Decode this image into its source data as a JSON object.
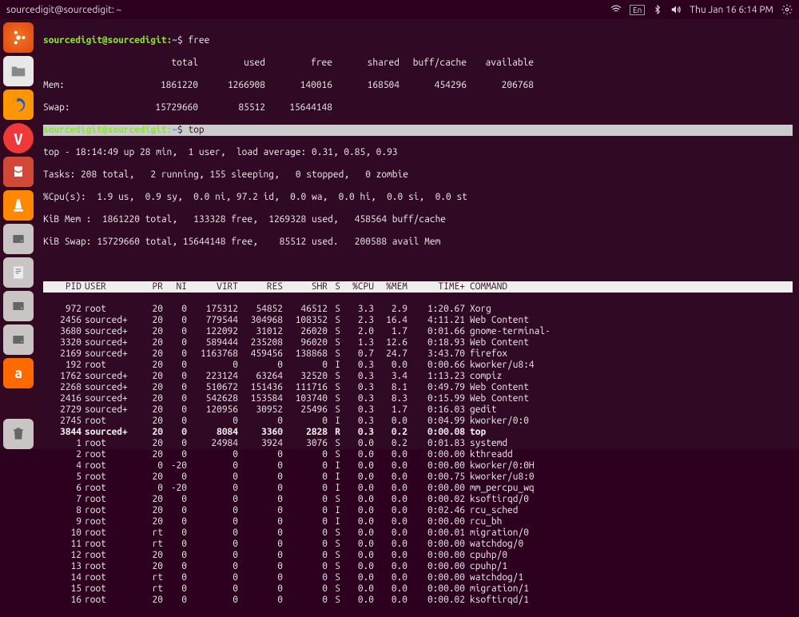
{
  "topbar": {
    "title": "sourcedigit@sourcedigit: ~",
    "lang": "En",
    "date": "Thu Jan 16  6:14 PM"
  },
  "prompt": {
    "user_host": "sourcedigit@sourcedigit",
    "path": "~",
    "cmd_free": "free",
    "cmd_top": "top"
  },
  "free": {
    "hdr_total": "total",
    "hdr_used": "used",
    "hdr_free": "free",
    "hdr_shared": "shared",
    "hdr_buff": "buff/cache",
    "hdr_avail": "available",
    "mem_label": "Mem:",
    "mem_total": "1861220",
    "mem_used": "1266908",
    "mem_free": "140016",
    "mem_shared": "168504",
    "mem_buff": "454296",
    "mem_avail": "206768",
    "swap_label": "Swap:",
    "swap_total": "15729660",
    "swap_used": "85512",
    "swap_free": "15644148"
  },
  "top_summary": {
    "line1_a": "top - 18:14:49 up 28 min,  1 user,  load average: 0.31, 0.85, 0.93",
    "line2": "Tasks: 208 total,   2 running, 155 sleeping,   0 stopped,   0 zombie",
    "line3": "%Cpu(s):  1.9 us,  0.9 sy,  0.0 ni, 97.2 id,  0.0 wa,  0.0 hi,  0.0 si,  0.0 st",
    "line4": "KiB Mem :  1861220 total,   133328 free,  1269328 used,   458564 buff/cache",
    "line5": "KiB Swap: 15729660 total, 15644148 free,    85512 used.   200588 avail Mem"
  },
  "col": {
    "pid": "PID",
    "user": "USER",
    "pr": "PR",
    "ni": "NI",
    "virt": "VIRT",
    "res": "RES",
    "shr": "SHR",
    "s": "S",
    "cpu": "%CPU",
    "mem": "%MEM",
    "time": "TIME+",
    "cmd": "COMMAND"
  },
  "procs": [
    {
      "pid": "972",
      "user": "root",
      "pr": "20",
      "ni": "0",
      "virt": "175312",
      "res": "54852",
      "shr": "46512",
      "s": "S",
      "cpu": "3.3",
      "mem": "2.9",
      "time": "1:20.67",
      "cmd": "Xorg"
    },
    {
      "pid": "2456",
      "user": "sourced+",
      "pr": "20",
      "ni": "0",
      "virt": "779544",
      "res": "304968",
      "shr": "108352",
      "s": "S",
      "cpu": "2.3",
      "mem": "16.4",
      "time": "4:11.21",
      "cmd": "Web Content"
    },
    {
      "pid": "3680",
      "user": "sourced+",
      "pr": "20",
      "ni": "0",
      "virt": "122092",
      "res": "31012",
      "shr": "26020",
      "s": "S",
      "cpu": "2.0",
      "mem": "1.7",
      "time": "0:01.66",
      "cmd": "gnome-terminal-"
    },
    {
      "pid": "3320",
      "user": "sourced+",
      "pr": "20",
      "ni": "0",
      "virt": "589444",
      "res": "235208",
      "shr": "96020",
      "s": "S",
      "cpu": "1.3",
      "mem": "12.6",
      "time": "0:18.93",
      "cmd": "Web Content"
    },
    {
      "pid": "2169",
      "user": "sourced+",
      "pr": "20",
      "ni": "0",
      "virt": "1163768",
      "res": "459456",
      "shr": "138868",
      "s": "S",
      "cpu": "0.7",
      "mem": "24.7",
      "time": "3:43.70",
      "cmd": "firefox"
    },
    {
      "pid": "192",
      "user": "root",
      "pr": "20",
      "ni": "0",
      "virt": "0",
      "res": "0",
      "shr": "0",
      "s": "I",
      "cpu": "0.3",
      "mem": "0.0",
      "time": "0:00.66",
      "cmd": "kworker/u8:4"
    },
    {
      "pid": "1762",
      "user": "sourced+",
      "pr": "20",
      "ni": "0",
      "virt": "223124",
      "res": "63264",
      "shr": "32520",
      "s": "S",
      "cpu": "0.3",
      "mem": "3.4",
      "time": "1:13.23",
      "cmd": "compiz"
    },
    {
      "pid": "2268",
      "user": "sourced+",
      "pr": "20",
      "ni": "0",
      "virt": "510672",
      "res": "151436",
      "shr": "111716",
      "s": "S",
      "cpu": "0.3",
      "mem": "8.1",
      "time": "0:49.79",
      "cmd": "Web Content"
    },
    {
      "pid": "2416",
      "user": "sourced+",
      "pr": "20",
      "ni": "0",
      "virt": "542628",
      "res": "153584",
      "shr": "103740",
      "s": "S",
      "cpu": "0.3",
      "mem": "8.3",
      "time": "0:15.99",
      "cmd": "Web Content"
    },
    {
      "pid": "2729",
      "user": "sourced+",
      "pr": "20",
      "ni": "0",
      "virt": "120956",
      "res": "30952",
      "shr": "25496",
      "s": "S",
      "cpu": "0.3",
      "mem": "1.7",
      "time": "0:16.03",
      "cmd": "gedit"
    },
    {
      "pid": "2745",
      "user": "root",
      "pr": "20",
      "ni": "0",
      "virt": "0",
      "res": "0",
      "shr": "0",
      "s": "I",
      "cpu": "0.3",
      "mem": "0.0",
      "time": "0:04.99",
      "cmd": "kworker/0:0"
    },
    {
      "pid": "3844",
      "user": "sourced+",
      "pr": "20",
      "ni": "0",
      "virt": "8084",
      "res": "3360",
      "shr": "2828",
      "s": "R",
      "cpu": "0.3",
      "mem": "0.2",
      "time": "0:00.08",
      "cmd": "top",
      "bold": true
    },
    {
      "pid": "1",
      "user": "root",
      "pr": "20",
      "ni": "0",
      "virt": "24984",
      "res": "3924",
      "shr": "3076",
      "s": "S",
      "cpu": "0.0",
      "mem": "0.2",
      "time": "0:01.83",
      "cmd": "systemd"
    },
    {
      "pid": "2",
      "user": "root",
      "pr": "20",
      "ni": "0",
      "virt": "0",
      "res": "0",
      "shr": "0",
      "s": "S",
      "cpu": "0.0",
      "mem": "0.0",
      "time": "0:00.00",
      "cmd": "kthreadd"
    },
    {
      "pid": "4",
      "user": "root",
      "pr": "0",
      "ni": "-20",
      "virt": "0",
      "res": "0",
      "shr": "0",
      "s": "I",
      "cpu": "0.0",
      "mem": "0.0",
      "time": "0:00.00",
      "cmd": "kworker/0:0H"
    },
    {
      "pid": "5",
      "user": "root",
      "pr": "20",
      "ni": "0",
      "virt": "0",
      "res": "0",
      "shr": "0",
      "s": "I",
      "cpu": "0.0",
      "mem": "0.0",
      "time": "0:00.75",
      "cmd": "kworker/u8:0"
    },
    {
      "pid": "6",
      "user": "root",
      "pr": "0",
      "ni": "-20",
      "virt": "0",
      "res": "0",
      "shr": "0",
      "s": "I",
      "cpu": "0.0",
      "mem": "0.0",
      "time": "0:00.00",
      "cmd": "mm_percpu_wq"
    },
    {
      "pid": "7",
      "user": "root",
      "pr": "20",
      "ni": "0",
      "virt": "0",
      "res": "0",
      "shr": "0",
      "s": "S",
      "cpu": "0.0",
      "mem": "0.0",
      "time": "0:00.02",
      "cmd": "ksoftirqd/0"
    },
    {
      "pid": "8",
      "user": "root",
      "pr": "20",
      "ni": "0",
      "virt": "0",
      "res": "0",
      "shr": "0",
      "s": "I",
      "cpu": "0.0",
      "mem": "0.0",
      "time": "0:02.46",
      "cmd": "rcu_sched"
    },
    {
      "pid": "9",
      "user": "root",
      "pr": "20",
      "ni": "0",
      "virt": "0",
      "res": "0",
      "shr": "0",
      "s": "I",
      "cpu": "0.0",
      "mem": "0.0",
      "time": "0:00.00",
      "cmd": "rcu_bh"
    },
    {
      "pid": "10",
      "user": "root",
      "pr": "rt",
      "ni": "0",
      "virt": "0",
      "res": "0",
      "shr": "0",
      "s": "S",
      "cpu": "0.0",
      "mem": "0.0",
      "time": "0:00.01",
      "cmd": "migration/0"
    },
    {
      "pid": "11",
      "user": "root",
      "pr": "rt",
      "ni": "0",
      "virt": "0",
      "res": "0",
      "shr": "0",
      "s": "S",
      "cpu": "0.0",
      "mem": "0.0",
      "time": "0:00.00",
      "cmd": "watchdog/0"
    },
    {
      "pid": "12",
      "user": "root",
      "pr": "20",
      "ni": "0",
      "virt": "0",
      "res": "0",
      "shr": "0",
      "s": "S",
      "cpu": "0.0",
      "mem": "0.0",
      "time": "0:00.00",
      "cmd": "cpuhp/0"
    },
    {
      "pid": "13",
      "user": "root",
      "pr": "20",
      "ni": "0",
      "virt": "0",
      "res": "0",
      "shr": "0",
      "s": "S",
      "cpu": "0.0",
      "mem": "0.0",
      "time": "0:00.00",
      "cmd": "cpuhp/1"
    },
    {
      "pid": "14",
      "user": "root",
      "pr": "rt",
      "ni": "0",
      "virt": "0",
      "res": "0",
      "shr": "0",
      "s": "S",
      "cpu": "0.0",
      "mem": "0.0",
      "time": "0:00.00",
      "cmd": "watchdog/1"
    },
    {
      "pid": "15",
      "user": "root",
      "pr": "rt",
      "ni": "0",
      "virt": "0",
      "res": "0",
      "shr": "0",
      "s": "S",
      "cpu": "0.0",
      "mem": "0.0",
      "time": "0:00.00",
      "cmd": "migration/1"
    },
    {
      "pid": "16",
      "user": "root",
      "pr": "20",
      "ni": "0",
      "virt": "0",
      "res": "0",
      "shr": "0",
      "s": "S",
      "cpu": "0.0",
      "mem": "0.0",
      "time": "0:00.02",
      "cmd": "ksoftirqd/1"
    }
  ]
}
